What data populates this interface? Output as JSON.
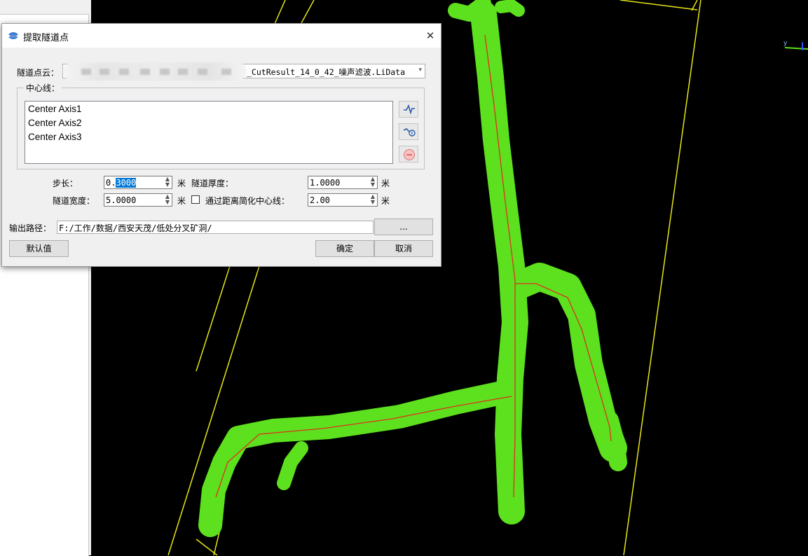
{
  "dialog": {
    "title": "提取隧道点",
    "close_glyph": "✕",
    "pointcloud_label": "隧道点云：",
    "pointcloud_value": "_CutResult_14_0_42_噪声滤波.LiData",
    "centerline_group": "中心线：",
    "centerlines": [
      "Center Axis1",
      "Center Axis2",
      "Center Axis3"
    ],
    "step_label": "步长：",
    "step_value_prefix": "0.",
    "step_value_selected": "3000",
    "thickness_label": "隧道厚度：",
    "thickness_value": "1.0000",
    "width_label": "隧道宽度：",
    "width_value": "5.0000",
    "simplify_label": "通过距离简化中心线：",
    "simplify_value": "2.00",
    "unit": "米",
    "output_label": "输出路径：",
    "output_value": "F:/工作/数据/西安天茂/低处分叉矿洞/",
    "browse_label": "...",
    "default_label": "默认值",
    "ok_label": "确定",
    "cancel_label": "取消"
  },
  "icons": {
    "app": "tunnel-app-icon",
    "add_centerline": "add-centerline-icon",
    "edit_centerline": "edit-centerline-icon",
    "remove_centerline": "remove-centerline-icon"
  },
  "viewport": {
    "axis_label": "y",
    "colors": {
      "background": "#000000",
      "point_cloud": "#5de01e",
      "centerline": "#e0301e",
      "bounding_box": "#e6e619"
    }
  }
}
